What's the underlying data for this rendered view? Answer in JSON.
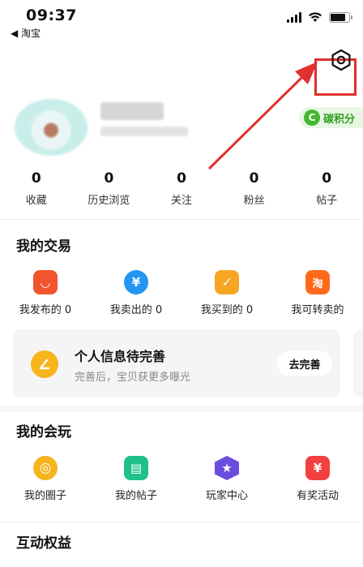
{
  "status_bar": {
    "time": "09:37",
    "back_app": "◀ 淘宝"
  },
  "profile": {
    "carbon_badge": {
      "icon": "C",
      "label": "碳积分",
      "color": "#45b72f"
    }
  },
  "stats": [
    {
      "value": "0",
      "label": "收藏"
    },
    {
      "value": "0",
      "label": "历史浏览"
    },
    {
      "value": "0",
      "label": "关注"
    },
    {
      "value": "0",
      "label": "粉丝"
    },
    {
      "value": "0",
      "label": "帖子"
    }
  ],
  "trade": {
    "title": "我的交易",
    "items": [
      {
        "label": "我发布的 0",
        "icon": "bag-icon",
        "glyph": "◡",
        "color": "#f2542d"
      },
      {
        "label": "我卖出的 0",
        "icon": "yuan-icon",
        "glyph": "¥",
        "color": "#2196f3"
      },
      {
        "label": "我买到的 0",
        "icon": "check-icon",
        "glyph": "✓",
        "color": "#f6a623"
      },
      {
        "label": "我可转卖的",
        "icon": "taobao-icon",
        "glyph": "淘",
        "color": "#ff6a1a"
      }
    ],
    "profile_card": {
      "title": "个人信息待完善",
      "subtitle": "完善后，宝贝获更多曝光",
      "button": "去完善",
      "icon_color": "#f6b41d"
    }
  },
  "play": {
    "title": "我的会玩",
    "items": [
      {
        "label": "我的圈子",
        "icon": "circle-icon",
        "glyph": "◎",
        "color": "#f6b41d"
      },
      {
        "label": "我的帖子",
        "icon": "post-icon",
        "glyph": "▤",
        "color": "#1fc08a"
      },
      {
        "label": "玩家中心",
        "icon": "star-icon",
        "glyph": "★",
        "color": "#6a4ce0"
      },
      {
        "label": "有奖活动",
        "icon": "prize-icon",
        "glyph": "¥",
        "color": "#f24040"
      }
    ]
  },
  "rights": {
    "title": "互动权益"
  },
  "colors": {
    "highlight": "#e0312e"
  }
}
